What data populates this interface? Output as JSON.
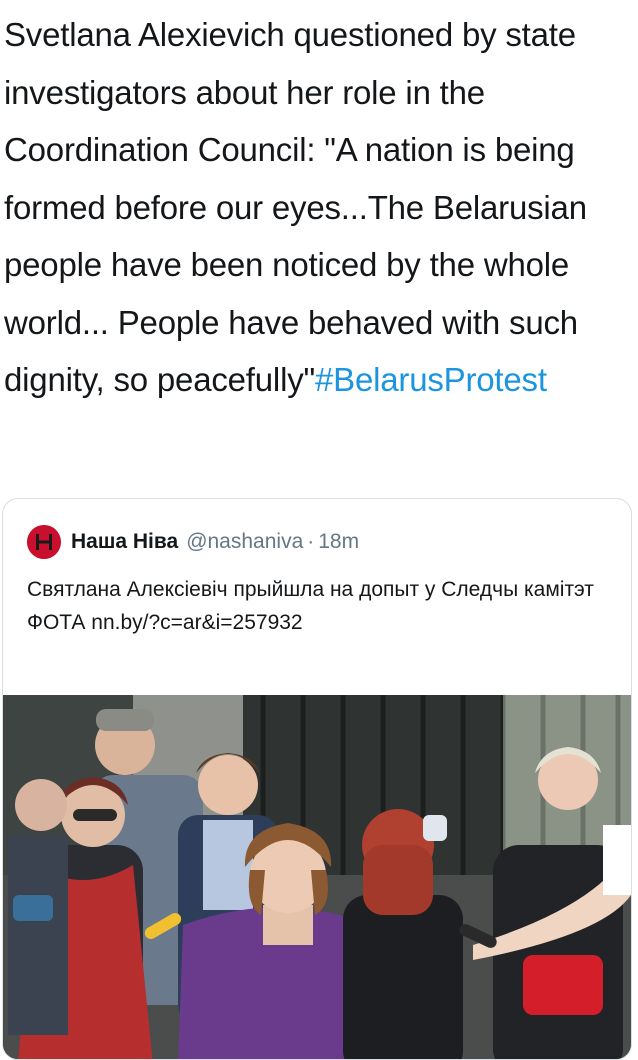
{
  "tweet": {
    "text_part1": "Svetlana Alexievich questioned by state investigators about her role in the Coordination Council: \"A nation is being formed before our eyes...The Belarusian people have been noticed by the whole world... People have behaved with such dignity, so peacefully\"",
    "hashtag": "#BelarusProtest"
  },
  "quote": {
    "display_name": "Наша Ніва",
    "handle": "@nashaniva",
    "separator": "·",
    "time": "18m",
    "text": "Святлана Алексіевіч прыйшла на допыт у Следчы камітэт ФОТА  nn.by/?c=ar&i=257932"
  },
  "colors": {
    "link": "#1b95e0",
    "avatar_red": "#c8102e",
    "muted": "#657786",
    "accent_purple": "#6a3a8c"
  }
}
